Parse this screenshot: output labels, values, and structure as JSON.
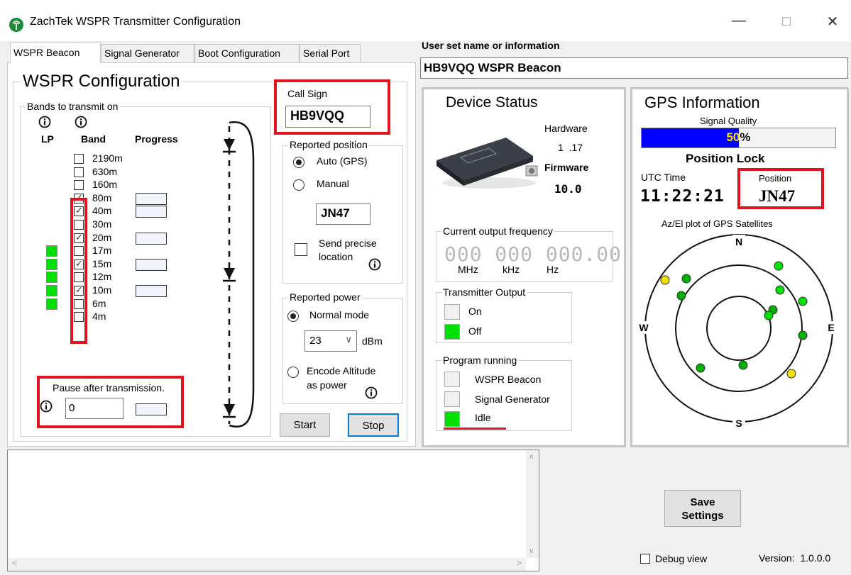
{
  "window": {
    "title": "ZachTek WSPR Transmitter Configuration",
    "minimize": "—",
    "maximize": "☐",
    "close": "✕",
    "icon": "antenna-icon"
  },
  "tabs": [
    "WSPR Beacon",
    "Signal Generator",
    "Boot Configuration",
    "Serial Port"
  ],
  "user_info": {
    "label": "User set name or information",
    "value": "HB9VQQ WSPR Beacon"
  },
  "wspr": {
    "title": "WSPR Configuration",
    "bands_group": "Bands to transmit on",
    "col_lp": "LP",
    "col_band": "Band",
    "col_progress": "Progress",
    "bands": [
      {
        "name": "2190m",
        "checked": false,
        "lp": false,
        "progress": false
      },
      {
        "name": "630m",
        "checked": false,
        "lp": false,
        "progress": false
      },
      {
        "name": "160m",
        "checked": false,
        "lp": false,
        "progress": false
      },
      {
        "name": "80m",
        "checked": true,
        "lp": false,
        "progress": true
      },
      {
        "name": "40m",
        "checked": true,
        "lp": false,
        "progress": true
      },
      {
        "name": "30m",
        "checked": false,
        "lp": false,
        "progress": false
      },
      {
        "name": "20m",
        "checked": true,
        "lp": false,
        "progress": true
      },
      {
        "name": "17m",
        "checked": false,
        "lp": true,
        "progress": false
      },
      {
        "name": "15m",
        "checked": true,
        "lp": true,
        "progress": true
      },
      {
        "name": "12m",
        "checked": false,
        "lp": true,
        "progress": false
      },
      {
        "name": "10m",
        "checked": true,
        "lp": true,
        "progress": true
      },
      {
        "name": "6m",
        "checked": false,
        "lp": true,
        "progress": false
      },
      {
        "name": "4m",
        "checked": false,
        "lp": false,
        "progress": false
      }
    ],
    "pause_label": "Pause after transmission.",
    "pause_value": "0",
    "callsign_label": "Call Sign",
    "callsign_value": "HB9VQQ",
    "position_group": "Reported position",
    "pos_auto": "Auto (GPS)",
    "pos_manual": "Manual",
    "locator": "JN47",
    "precise_line1": "Send precise",
    "precise_line2": "location",
    "power_group": "Reported power",
    "power_normal": "Normal mode",
    "power_value": "23",
    "power_unit": "dBm",
    "encode_line1": "Encode Altitude",
    "encode_line2": "as power",
    "start": "Start",
    "stop": "Stop"
  },
  "device": {
    "title": "Device Status",
    "hardware_label": "Hardware",
    "hardware_value": "1  .17",
    "firmware_label": "Firmware",
    "firmware_value": "10.0",
    "freq_group": "Current output frequency",
    "freq_value": "000 000 000.00",
    "unit_mhz": "MHz",
    "unit_khz": "kHz",
    "unit_hz": "Hz",
    "tx_group": "Transmitter Output",
    "tx_on": "On",
    "tx_off": "Off",
    "prog_group": "Program running",
    "prog_wspr": "WSPR Beacon",
    "prog_siggen": "Signal Generator",
    "prog_idle": "Idle"
  },
  "gps": {
    "title": "GPS Information",
    "signal_label": "Signal Quality",
    "signal_text": "50%",
    "signal_fraction": 0.5,
    "lock_label": "Position Lock",
    "utc_label": "UTC Time",
    "utc_value": "11:22:21",
    "pos_label": "Position",
    "pos_value": "JN47",
    "plot_label": "Az/El plot of GPS Satellites",
    "n": "N",
    "e": "E",
    "s": "S",
    "w": "W"
  },
  "footer": {
    "save_line1": "Save",
    "save_line2": "Settings",
    "debug_label": "Debug view",
    "version": "Version:  1.0.0.0"
  },
  "colors": {
    "accent_red": "#e0141e",
    "green": "#00e000",
    "signal_blue": "#0000ff",
    "yellow_text": "#ffe000"
  }
}
